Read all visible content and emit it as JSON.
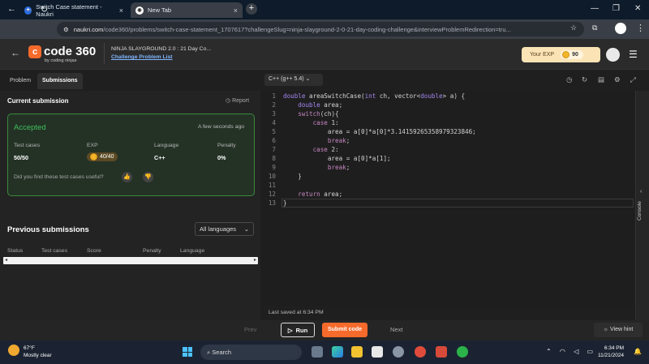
{
  "browser": {
    "tabs": [
      {
        "label": "Switch Case statement - Naukri",
        "icon": "coding-ninjas-icon",
        "active": false
      },
      {
        "label": "New Tab",
        "icon": "chrome-icon",
        "active": true
      }
    ],
    "url_host": "naukri.com",
    "url_path": "/code360/problems/switch-case-statement_1707617?challengeSlug=ninja-slayground-2-0-21-day-coding-challenge&interviewProblemRedirection=tru..."
  },
  "site": {
    "logo_text": "code 360",
    "logo_sub": "by coding ninjas",
    "breadcrumb_title": "NINJA SLAYGROUND 2.0 : 21 Day Co...",
    "breadcrumb_link": "Challenge Problem List",
    "exp_label": "Your EXP",
    "exp_value": "90"
  },
  "left": {
    "tabs": [
      "Problem",
      "Submissions"
    ],
    "current_title": "Current submission",
    "report": "Report",
    "status": "Accepted",
    "time": "A few seconds ago",
    "cols": [
      "Test cases",
      "EXP",
      "Language",
      "Penalty"
    ],
    "vals": {
      "testcases": "50/50",
      "exp": "40/40",
      "language": "C++",
      "penalty": "0%"
    },
    "useful_q": "Did you find these test cases useful?",
    "prev_title": "Previous submissions",
    "lang_filter": "All languages",
    "table_headers": [
      "Status",
      "Test cases",
      "Score",
      "Penalty",
      "Language"
    ]
  },
  "editor": {
    "language": "C++ (g++ 5.4)",
    "saved": "Last saved at 6:34 PM",
    "console": "Console",
    "lines": [
      "1",
      "2",
      "3",
      "4",
      "5",
      "6",
      "7",
      "8",
      "9",
      "10",
      "11",
      "12",
      "13"
    ]
  },
  "bottom": {
    "prev": "Prev",
    "run": "Run",
    "submit": "Submit code",
    "next": "Next",
    "hint": "View hint"
  },
  "taskbar": {
    "temp": "67°F",
    "weather": "Mostly clear",
    "search": "Search",
    "time": "6:34 PM",
    "date": "11/21/2024"
  },
  "colors": {
    "accent": "#f66a2c",
    "accepted": "#3fbf5a"
  }
}
